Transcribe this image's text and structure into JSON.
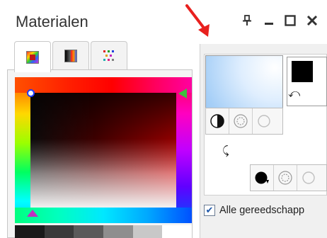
{
  "palette": {
    "title": "Materialen",
    "title_buttons": [
      "pin-icon",
      "minimize-icon",
      "maximize-icon",
      "close-icon"
    ],
    "annotation_arrow_color": "#e8201e"
  },
  "tabs": [
    {
      "name": "rainbow-picker-tab",
      "icon": "rainbow-picker-icon",
      "active": true
    },
    {
      "name": "frame-tab",
      "icon": "frame-icon",
      "active": false
    },
    {
      "name": "swatches-tab",
      "icon": "swatches-icon",
      "active": false
    }
  ],
  "picker": {
    "gray_strip": [
      "#1a1a1a",
      "#3a3a3a",
      "#5a5a5a",
      "#8e8e8e",
      "#c8c8c8",
      "#ffffff"
    ]
  },
  "foreground": {
    "color_hint": "#a6cff7",
    "props": [
      "style-color-icon",
      "texture-icon",
      "transparent-icon"
    ]
  },
  "background": {
    "color": "#000000",
    "props": [
      "style-color-icon",
      "texture-icon",
      "transparent-icon"
    ]
  },
  "options": {
    "all_tools_checked": true,
    "all_tools_label": "Alle gereedschapp"
  }
}
